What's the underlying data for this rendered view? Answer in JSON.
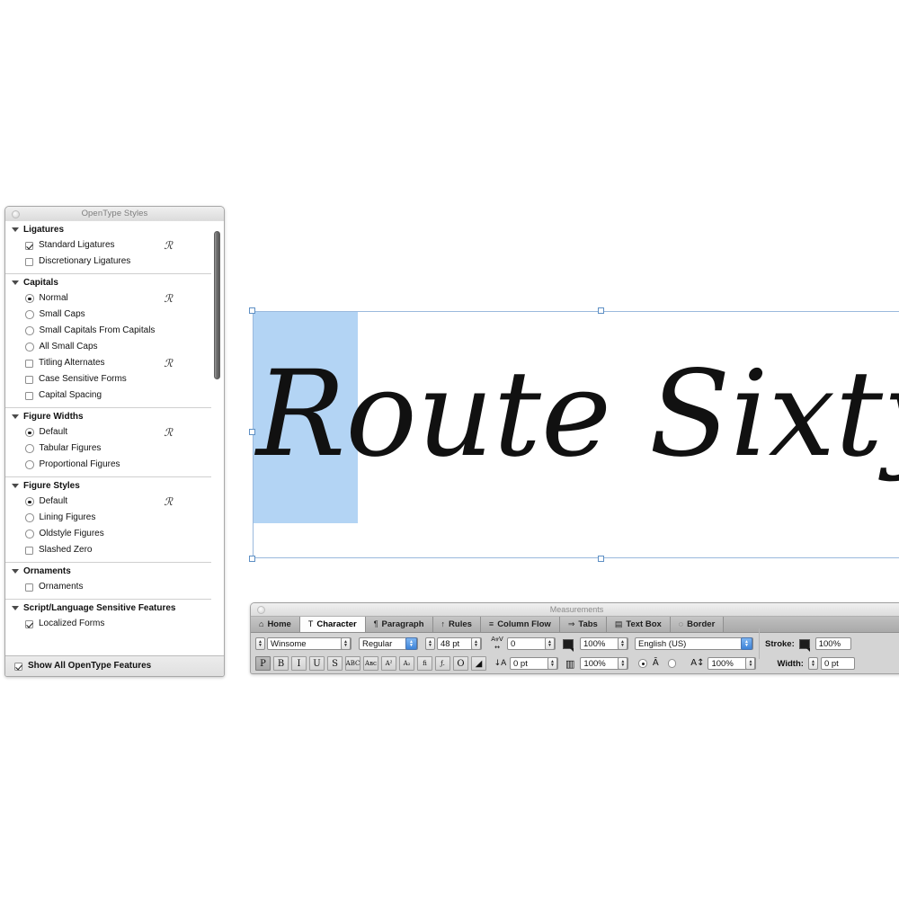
{
  "opentype_panel": {
    "title": "OpenType Styles",
    "groups": [
      {
        "heading": "Ligatures",
        "items": [
          {
            "label": "Standard Ligatures",
            "control": "checkbox",
            "checked": true,
            "swash": true
          },
          {
            "label": "Discretionary Ligatures",
            "control": "checkbox",
            "checked": false,
            "swash": false
          }
        ]
      },
      {
        "heading": "Capitals",
        "items": [
          {
            "label": "Normal",
            "control": "radio",
            "checked": true,
            "swash": true
          },
          {
            "label": "Small Caps",
            "control": "radio",
            "checked": false,
            "swash": false
          },
          {
            "label": "Small Capitals From Capitals",
            "control": "radio",
            "checked": false,
            "swash": false
          },
          {
            "label": "All Small Caps",
            "control": "radio",
            "checked": false,
            "swash": false
          },
          {
            "label": "Titling Alternates",
            "control": "checkbox",
            "checked": false,
            "swash": true
          },
          {
            "label": "Case Sensitive Forms",
            "control": "checkbox",
            "checked": false,
            "swash": false
          },
          {
            "label": "Capital Spacing",
            "control": "checkbox",
            "checked": false,
            "swash": false
          }
        ]
      },
      {
        "heading": "Figure Widths",
        "items": [
          {
            "label": "Default",
            "control": "radio",
            "checked": true,
            "swash": true
          },
          {
            "label": "Tabular Figures",
            "control": "radio",
            "checked": false,
            "swash": false
          },
          {
            "label": "Proportional Figures",
            "control": "radio",
            "checked": false,
            "swash": false
          }
        ]
      },
      {
        "heading": "Figure Styles",
        "items": [
          {
            "label": "Default",
            "control": "radio",
            "checked": true,
            "swash": true
          },
          {
            "label": "Lining Figures",
            "control": "radio",
            "checked": false,
            "swash": false
          },
          {
            "label": "Oldstyle Figures",
            "control": "radio",
            "checked": false,
            "swash": false
          },
          {
            "label": "Slashed Zero",
            "control": "checkbox",
            "checked": false,
            "swash": false
          }
        ]
      },
      {
        "heading": "Ornaments",
        "items": [
          {
            "label": "Ornaments",
            "control": "checkbox",
            "checked": false,
            "swash": false
          }
        ]
      },
      {
        "heading": "Script/Language Sensitive Features",
        "items": [
          {
            "label": "Localized Forms",
            "control": "checkbox",
            "checked": true,
            "swash": false
          }
        ]
      }
    ],
    "footer": {
      "label": "Show All OpenType Features",
      "checked": true
    },
    "swash_glyph": "ℛ"
  },
  "canvas": {
    "text": "Route Sixty Six",
    "selected_fragment": "R",
    "selection_highlight_color": "#b3d4f4",
    "selection_frame_color": "#9ab9dd",
    "text_color": "#111111"
  },
  "measurements": {
    "title": "Measurements",
    "tabs": [
      {
        "label": "Home",
        "icon": "⌂",
        "icon_name": "home-icon",
        "active": false
      },
      {
        "label": "Character",
        "icon": "T",
        "icon_name": "character-t-icon",
        "active": true
      },
      {
        "label": "Paragraph",
        "icon": "¶",
        "icon_name": "pilcrow-icon",
        "active": false
      },
      {
        "label": "Rules",
        "icon": "↑",
        "icon_name": "rules-icon",
        "active": false
      },
      {
        "label": "Column Flow",
        "icon": "≡",
        "icon_name": "column-flow-icon",
        "active": false
      },
      {
        "label": "Tabs",
        "icon": "⇒",
        "icon_name": "tabs-arrow-icon",
        "active": false
      },
      {
        "label": "Text Box",
        "icon": "▤",
        "icon_name": "text-box-icon",
        "active": false
      },
      {
        "label": "Border",
        "icon": "◌",
        "icon_name": "border-icon",
        "active": false
      }
    ],
    "character": {
      "font_family": "Winsome",
      "font_style": "Regular",
      "font_size": "48 pt",
      "tracking_label_icon": "AV",
      "tracking_value": "0",
      "baseline_shift_icon": "A",
      "baseline_shift_value": "0 pt",
      "horizontal_scale": "100%",
      "vertical_scale": "100%",
      "language": "English (US)",
      "type_scale_value": "100%",
      "style_buttons": [
        {
          "glyph": "P",
          "name": "plain-style-button",
          "selected": true
        },
        {
          "glyph": "B",
          "name": "bold-style-button",
          "selected": false
        },
        {
          "glyph": "I",
          "name": "italic-style-button",
          "selected": false
        },
        {
          "glyph": "U",
          "name": "underline-style-button",
          "selected": false
        },
        {
          "glyph": "S",
          "name": "strikethrough-style-button",
          "selected": false
        },
        {
          "glyph": "ABC",
          "name": "all-caps-style-button",
          "selected": false
        },
        {
          "glyph": "Aʙᴄ",
          "name": "small-caps-style-button",
          "selected": false
        },
        {
          "glyph": "A²",
          "name": "superscript-style-button",
          "selected": false
        },
        {
          "glyph": "A₂",
          "name": "subscript-style-button",
          "selected": false
        },
        {
          "glyph": "fi",
          "name": "ligature-style-button",
          "selected": false
        },
        {
          "glyph": "ƒ.",
          "name": "superior-style-button",
          "selected": false
        },
        {
          "glyph": "O",
          "name": "outline-style-button",
          "selected": false
        },
        {
          "glyph": "◢",
          "name": "shadow-style-button",
          "selected": false
        }
      ]
    },
    "border": {
      "stroke_label": "Stroke:",
      "stroke_value": "100%",
      "width_label": "Width:",
      "width_value": "0 pt"
    }
  }
}
